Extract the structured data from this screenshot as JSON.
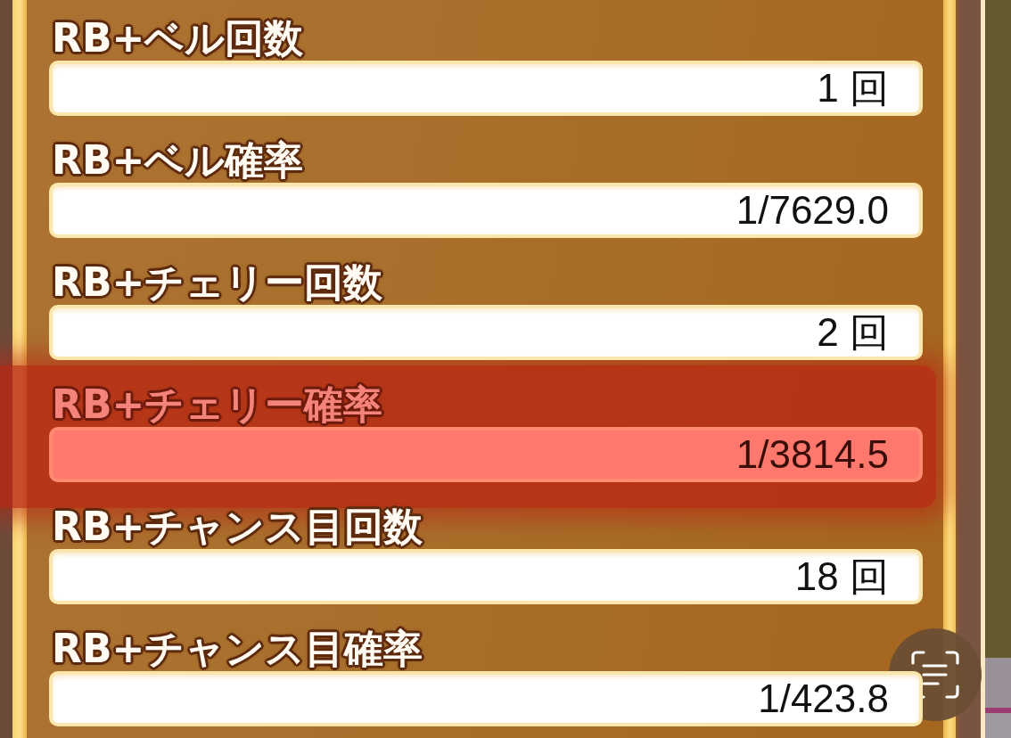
{
  "rows": [
    {
      "label": "RB+ベル回数",
      "value": "1 回",
      "selected": false
    },
    {
      "label": "RB+ベル確率",
      "value": "1/7629.0",
      "selected": false
    },
    {
      "label": "RB+チェリー回数",
      "value": "2 回",
      "selected": false
    },
    {
      "label": "RB+チェリー確率",
      "value": "1/3814.5",
      "selected": true
    },
    {
      "label": "RB+チャンス目回数",
      "value": "18 回",
      "selected": false
    },
    {
      "label": "RB+チャンス目確率",
      "value": "1/423.8",
      "selected": false
    }
  ]
}
